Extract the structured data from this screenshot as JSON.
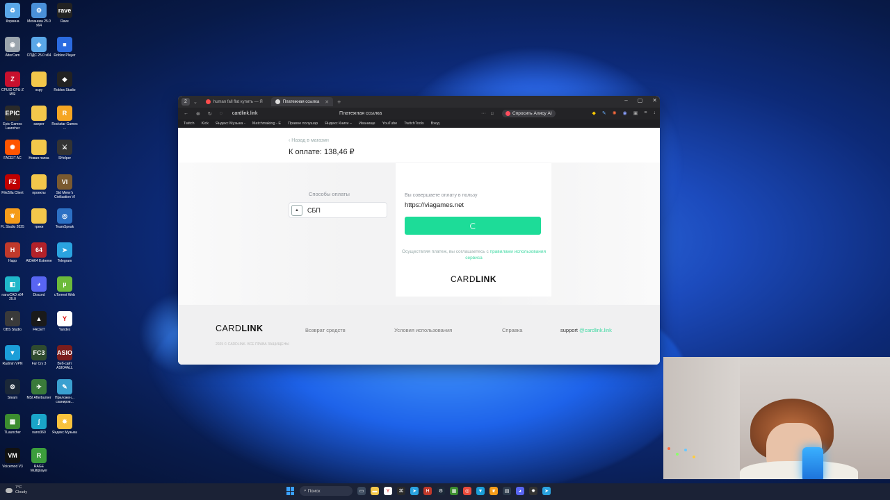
{
  "desktop": {
    "icons": [
      {
        "label": "Корзина",
        "icon": "recycle-bin-icon",
        "color": "#5aa7e8",
        "glyph": "♻"
      },
      {
        "label": "Механика 25.0 x64",
        "icon": "gear-app-icon",
        "color": "#4a90d9",
        "glyph": "⚙"
      },
      {
        "label": "Rave",
        "icon": "rave-icon",
        "color": "#222222",
        "glyph": "rave"
      },
      {
        "label": "AlterCam",
        "icon": "webcam-app-icon",
        "color": "#9aa4ad",
        "glyph": "◉"
      },
      {
        "label": "СПДС 25.0 x64",
        "icon": "spds-icon",
        "color": "#5aa7e8",
        "glyph": "◈"
      },
      {
        "label": "Roblox Player",
        "icon": "roblox-icon",
        "color": "#2b6be0",
        "glyph": "■"
      },
      {
        "label": "CPUID CPU-Z MSI",
        "icon": "cpuz-icon",
        "color": "#c8102e",
        "glyph": "Z"
      },
      {
        "label": "scpy",
        "icon": "folder-icon",
        "color": "#f3c74b",
        "glyph": ""
      },
      {
        "label": "Roblox Studio",
        "icon": "roblox-studio-icon",
        "color": "#222222",
        "glyph": "◆"
      },
      {
        "label": "Epic Games Launcher",
        "icon": "epic-games-icon",
        "color": "#2a2a2a",
        "glyph": "EPIC"
      },
      {
        "label": "sanper",
        "icon": "folder-icon",
        "color": "#f3c74b",
        "glyph": ""
      },
      {
        "label": "Rockstar Games ...",
        "icon": "rockstar-icon",
        "color": "#f5a623",
        "glyph": "R"
      },
      {
        "label": "FACEIT AC",
        "icon": "faceit-ac-icon",
        "color": "#ff5500",
        "glyph": "✺"
      },
      {
        "label": "Новая папка",
        "icon": "folder-icon",
        "color": "#f3c74b",
        "glyph": ""
      },
      {
        "label": "SHelper",
        "icon": "shelper-icon",
        "color": "#333333",
        "glyph": "⚔"
      },
      {
        "label": "FileZilla Client",
        "icon": "filezilla-icon",
        "color": "#bf0000",
        "glyph": "FZ"
      },
      {
        "label": "проекты",
        "icon": "folder-icon",
        "color": "#f3c74b",
        "glyph": ""
      },
      {
        "label": "Sid Meier's Civilization VI",
        "icon": "civ6-icon",
        "color": "#7a5a30",
        "glyph": "VI"
      },
      {
        "label": "FL Studio 2025",
        "icon": "fl-studio-icon",
        "color": "#f59c1a",
        "glyph": "❦"
      },
      {
        "label": "треки",
        "icon": "folder-icon",
        "color": "#f3c74b",
        "glyph": ""
      },
      {
        "label": "TeamSpeak",
        "icon": "teamspeak-icon",
        "color": "#2c70c4",
        "glyph": "◎"
      },
      {
        "label": "Happ",
        "icon": "happ-icon",
        "color": "#c0392b",
        "glyph": "H"
      },
      {
        "label": "AIDA64 Extreme",
        "icon": "aida64-icon",
        "color": "#b3222a",
        "glyph": "64"
      },
      {
        "label": "Telegram",
        "icon": "telegram-icon",
        "color": "#2aa3e0",
        "glyph": "➤"
      },
      {
        "label": "nanoCAD x64 25.0",
        "icon": "nanocad-icon",
        "color": "#1fb7c9",
        "glyph": "◧"
      },
      {
        "label": "Discord",
        "icon": "discord-icon",
        "color": "#5865f2",
        "glyph": "◕"
      },
      {
        "label": "uTorrent Web",
        "icon": "utorrent-icon",
        "color": "#6cba3a",
        "glyph": "µ"
      },
      {
        "label": "OBS Studio",
        "icon": "obs-icon",
        "color": "#3a3a3a",
        "glyph": "◐"
      },
      {
        "label": "FACEIT",
        "icon": "faceit-icon",
        "color": "#1a1a1a",
        "glyph": "▲"
      },
      {
        "label": "Yandex",
        "icon": "yandex-browser-icon",
        "color": "#ffffff",
        "glyph": "Y"
      },
      {
        "label": "Radmin VPN",
        "icon": "radmin-vpn-icon",
        "color": "#1b9ed8",
        "glyph": "▼"
      },
      {
        "label": "Far Cry 3",
        "icon": "farcry3-icon",
        "color": "#2f4b2f",
        "glyph": "FC3"
      },
      {
        "label": "Веб-сайт ASIO4ALL",
        "icon": "asio4all-icon",
        "color": "#7a1d1d",
        "glyph": "ASIO"
      },
      {
        "label": "Steam",
        "icon": "steam-icon",
        "color": "#1b2838",
        "glyph": "⚙"
      },
      {
        "label": "MSI Afterburner",
        "icon": "afterburner-icon",
        "color": "#3a7a3a",
        "glyph": "✈"
      },
      {
        "label": "Приложен... сканиров...",
        "icon": "scanner-app-icon",
        "color": "#3aa0d0",
        "glyph": "✎"
      },
      {
        "label": "TLauncher",
        "icon": "tlauncher-icon",
        "color": "#3c8d2f",
        "glyph": "▦"
      },
      {
        "label": "nano360",
        "icon": "nano360-icon",
        "color": "#1aa5c8",
        "glyph": "∫"
      },
      {
        "label": "Яндекс Музыка",
        "icon": "yandex-music-icon",
        "color": "#f9c23c",
        "glyph": "✸"
      },
      {
        "label": "Voicemod V3",
        "icon": "voicemod-icon",
        "color": "#111111",
        "glyph": "VM"
      },
      {
        "label": "RAGE Multiplayer",
        "icon": "ragemp-icon",
        "color": "#3c9e3c",
        "glyph": "R"
      }
    ]
  },
  "browser": {
    "tab_count": "2",
    "tabs": [
      {
        "label": "human fall flat купить — Я",
        "active": false,
        "fav_color": "#ff4d4d"
      },
      {
        "label": "Платежная ссылка",
        "active": true,
        "fav_color": "#dddddd"
      }
    ],
    "url": "cardlink.link",
    "page_title": "Платежная ссылка",
    "alice_label": "Спросить Алису AI",
    "bookmarks": [
      "Twitch",
      "Kick",
      "Яндекс Музыка -",
      "Matchmaking - E",
      "Правое полушар",
      "Яндекс Книги –",
      "Иванище",
      "YouTube",
      "TwitchTools",
      "Вход"
    ]
  },
  "page": {
    "back_link": "Назад в магазин",
    "amount": "К оплате: 138,46 ₽",
    "methods_label": "Способы оплаты",
    "method": {
      "label": "СБП",
      "icon": "sbp-icon"
    },
    "pay_to_label": "Вы совершаете оплату в пользу",
    "site": "https://viagames.net",
    "agree_text": "Осуществляя платеж, вы соглашаетесь с ",
    "agree_link": "правилами использования сервиса",
    "logo_thin": "CARD",
    "logo_bold": "LINK",
    "footer": {
      "refund": "Возврат средств",
      "terms": "Условия использования",
      "help": "Справка",
      "support_label": "support",
      "support_email": "@cardlink.link",
      "copyright": "2025 © CARDLINK. ВСЕ ПРАВА ЗАЩИЩЕНЫ"
    },
    "accent_color": "#1ddc98"
  },
  "taskbar": {
    "weather_temp": "7°C",
    "weather_desc": "Cloudy",
    "search_label": "Поиск"
  }
}
